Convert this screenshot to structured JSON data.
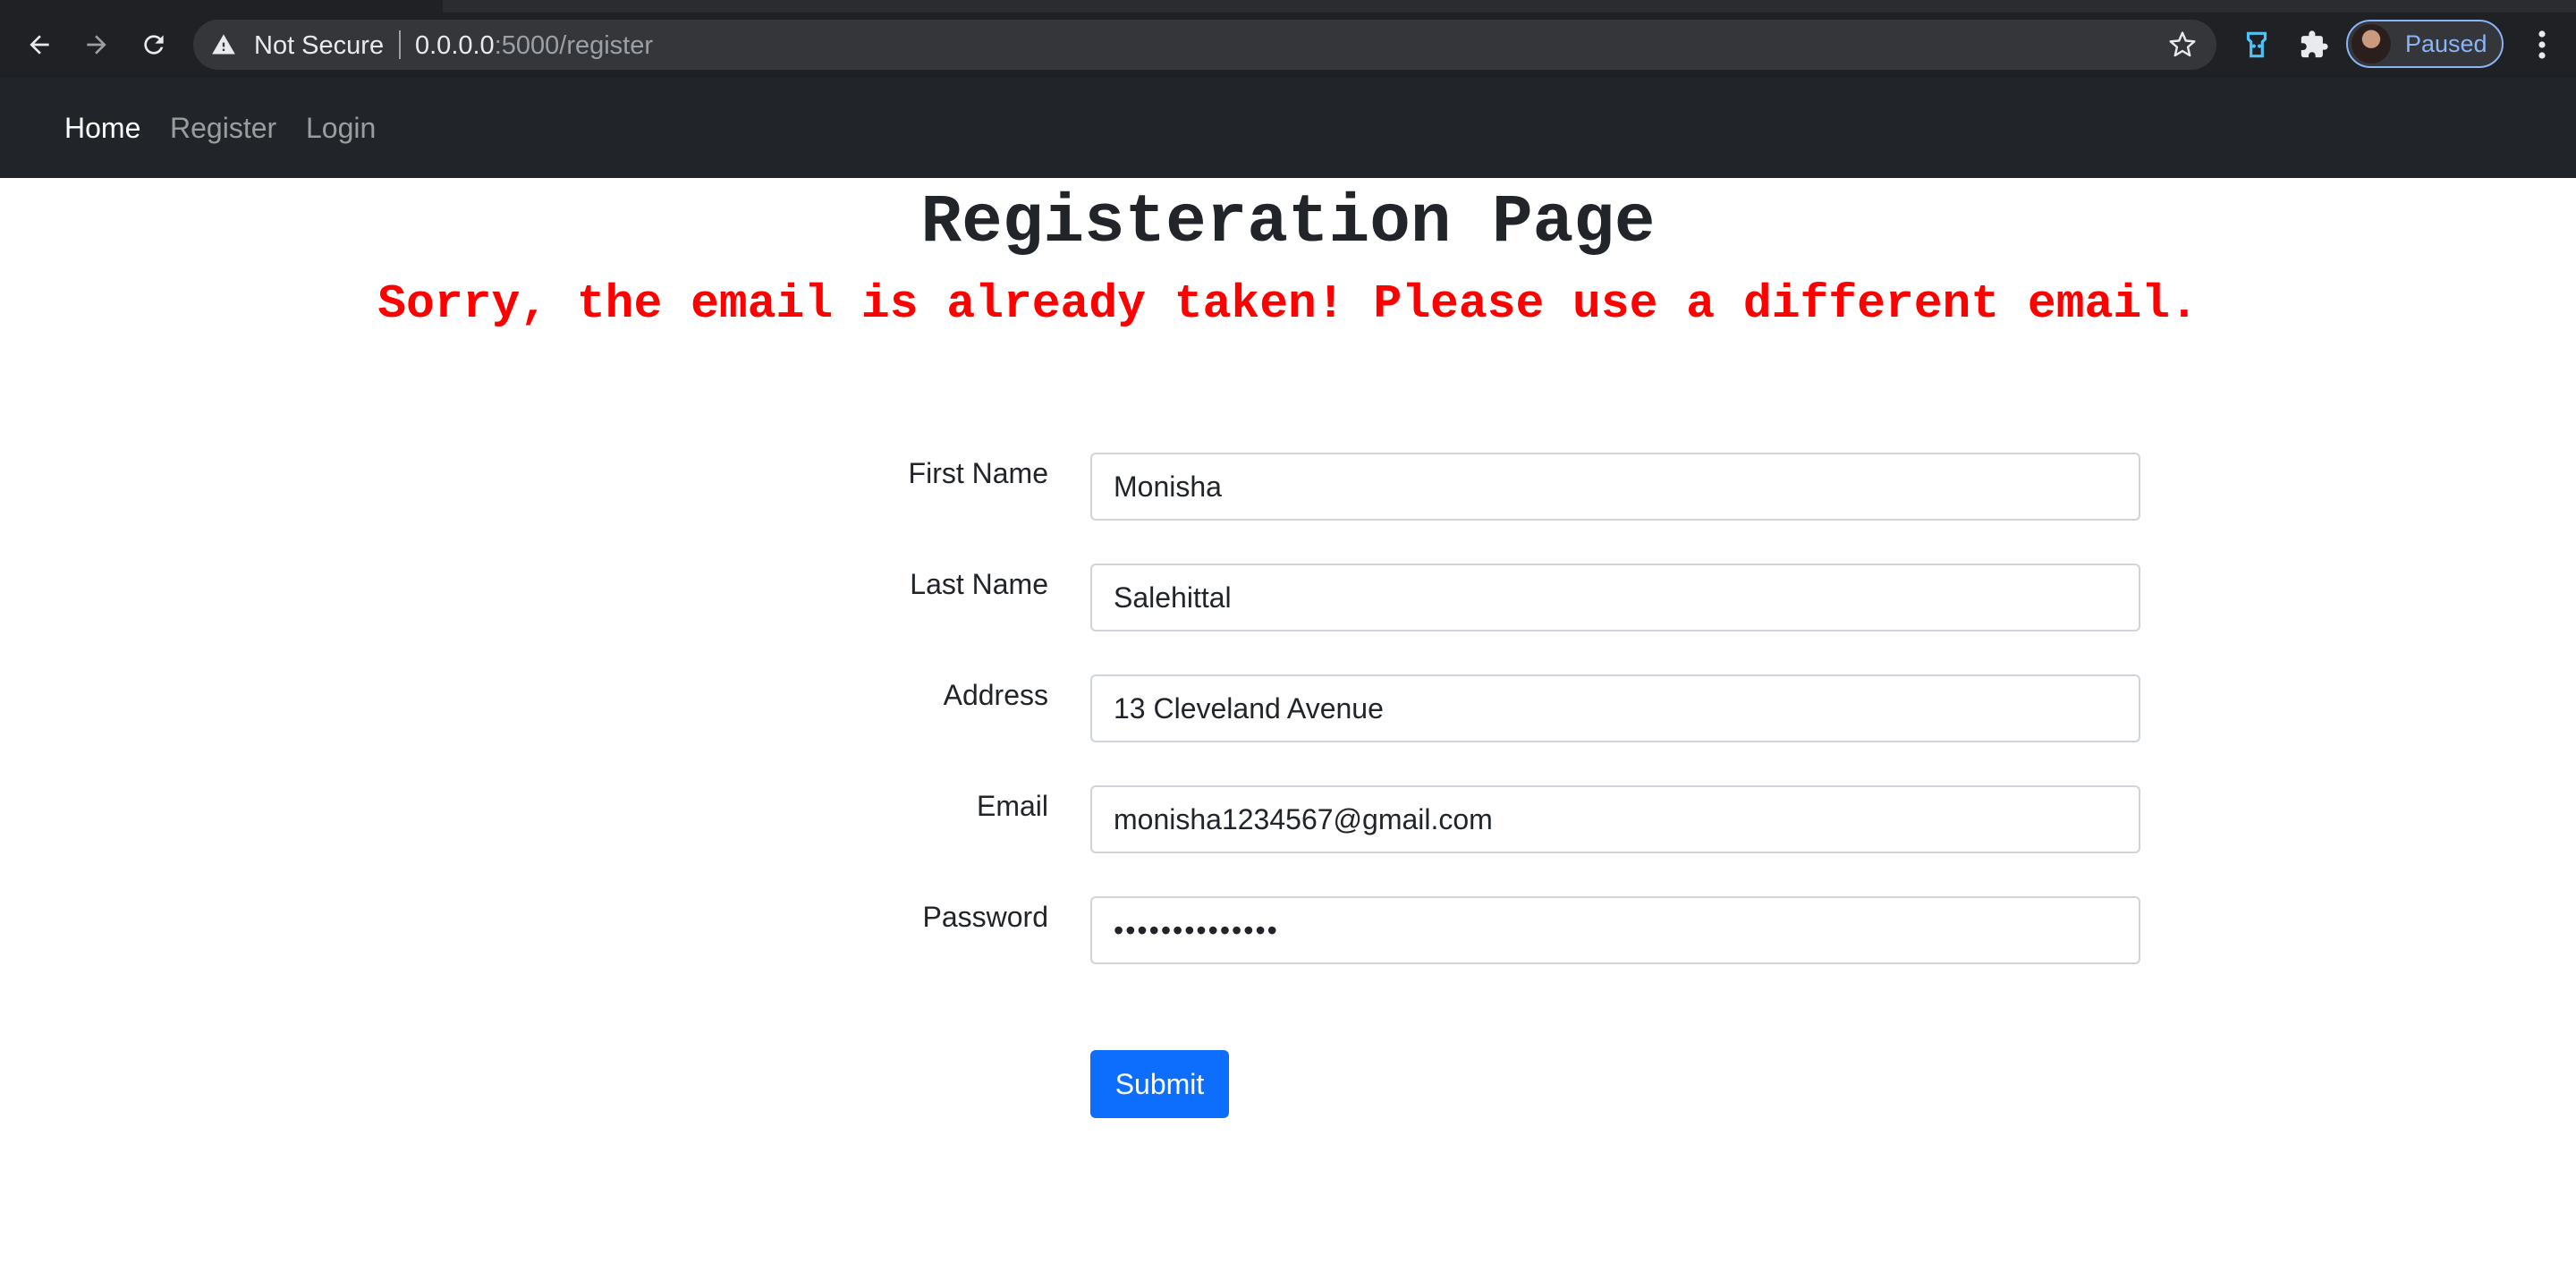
{
  "browser": {
    "security_label": "Not Secure",
    "url_host": "0.0.0.0",
    "url_path": ":5000/register",
    "profile_status": "Paused",
    "icons": [
      "back-arrow-icon",
      "forward-arrow-icon",
      "reload-icon",
      "warning-icon",
      "bookmark-star-icon",
      "extension-icon",
      "puzzle-icon",
      "kebab-menu-icon"
    ],
    "accent_color": "#8ab4f8"
  },
  "navbar": {
    "links": [
      {
        "label": "Home",
        "active": true
      },
      {
        "label": "Register",
        "active": false
      },
      {
        "label": "Login",
        "active": false
      }
    ]
  },
  "page": {
    "title": "Registeration Page",
    "error": "Sorry, the email is already taken! Please use a different email.",
    "error_color": "#ff0000"
  },
  "form": {
    "fields": [
      {
        "label": "First Name",
        "value": "Monisha",
        "type": "text"
      },
      {
        "label": "Last Name",
        "value": "Salehittal",
        "type": "text"
      },
      {
        "label": "Address",
        "value": "13 Cleveland Avenue",
        "type": "text"
      },
      {
        "label": "Email",
        "value": "monisha1234567@gmail.com",
        "type": "email"
      },
      {
        "label": "Password",
        "value": "••••••••••••••",
        "type": "password"
      }
    ],
    "submit_label": "Submit",
    "submit_color": "#0d6efd"
  }
}
